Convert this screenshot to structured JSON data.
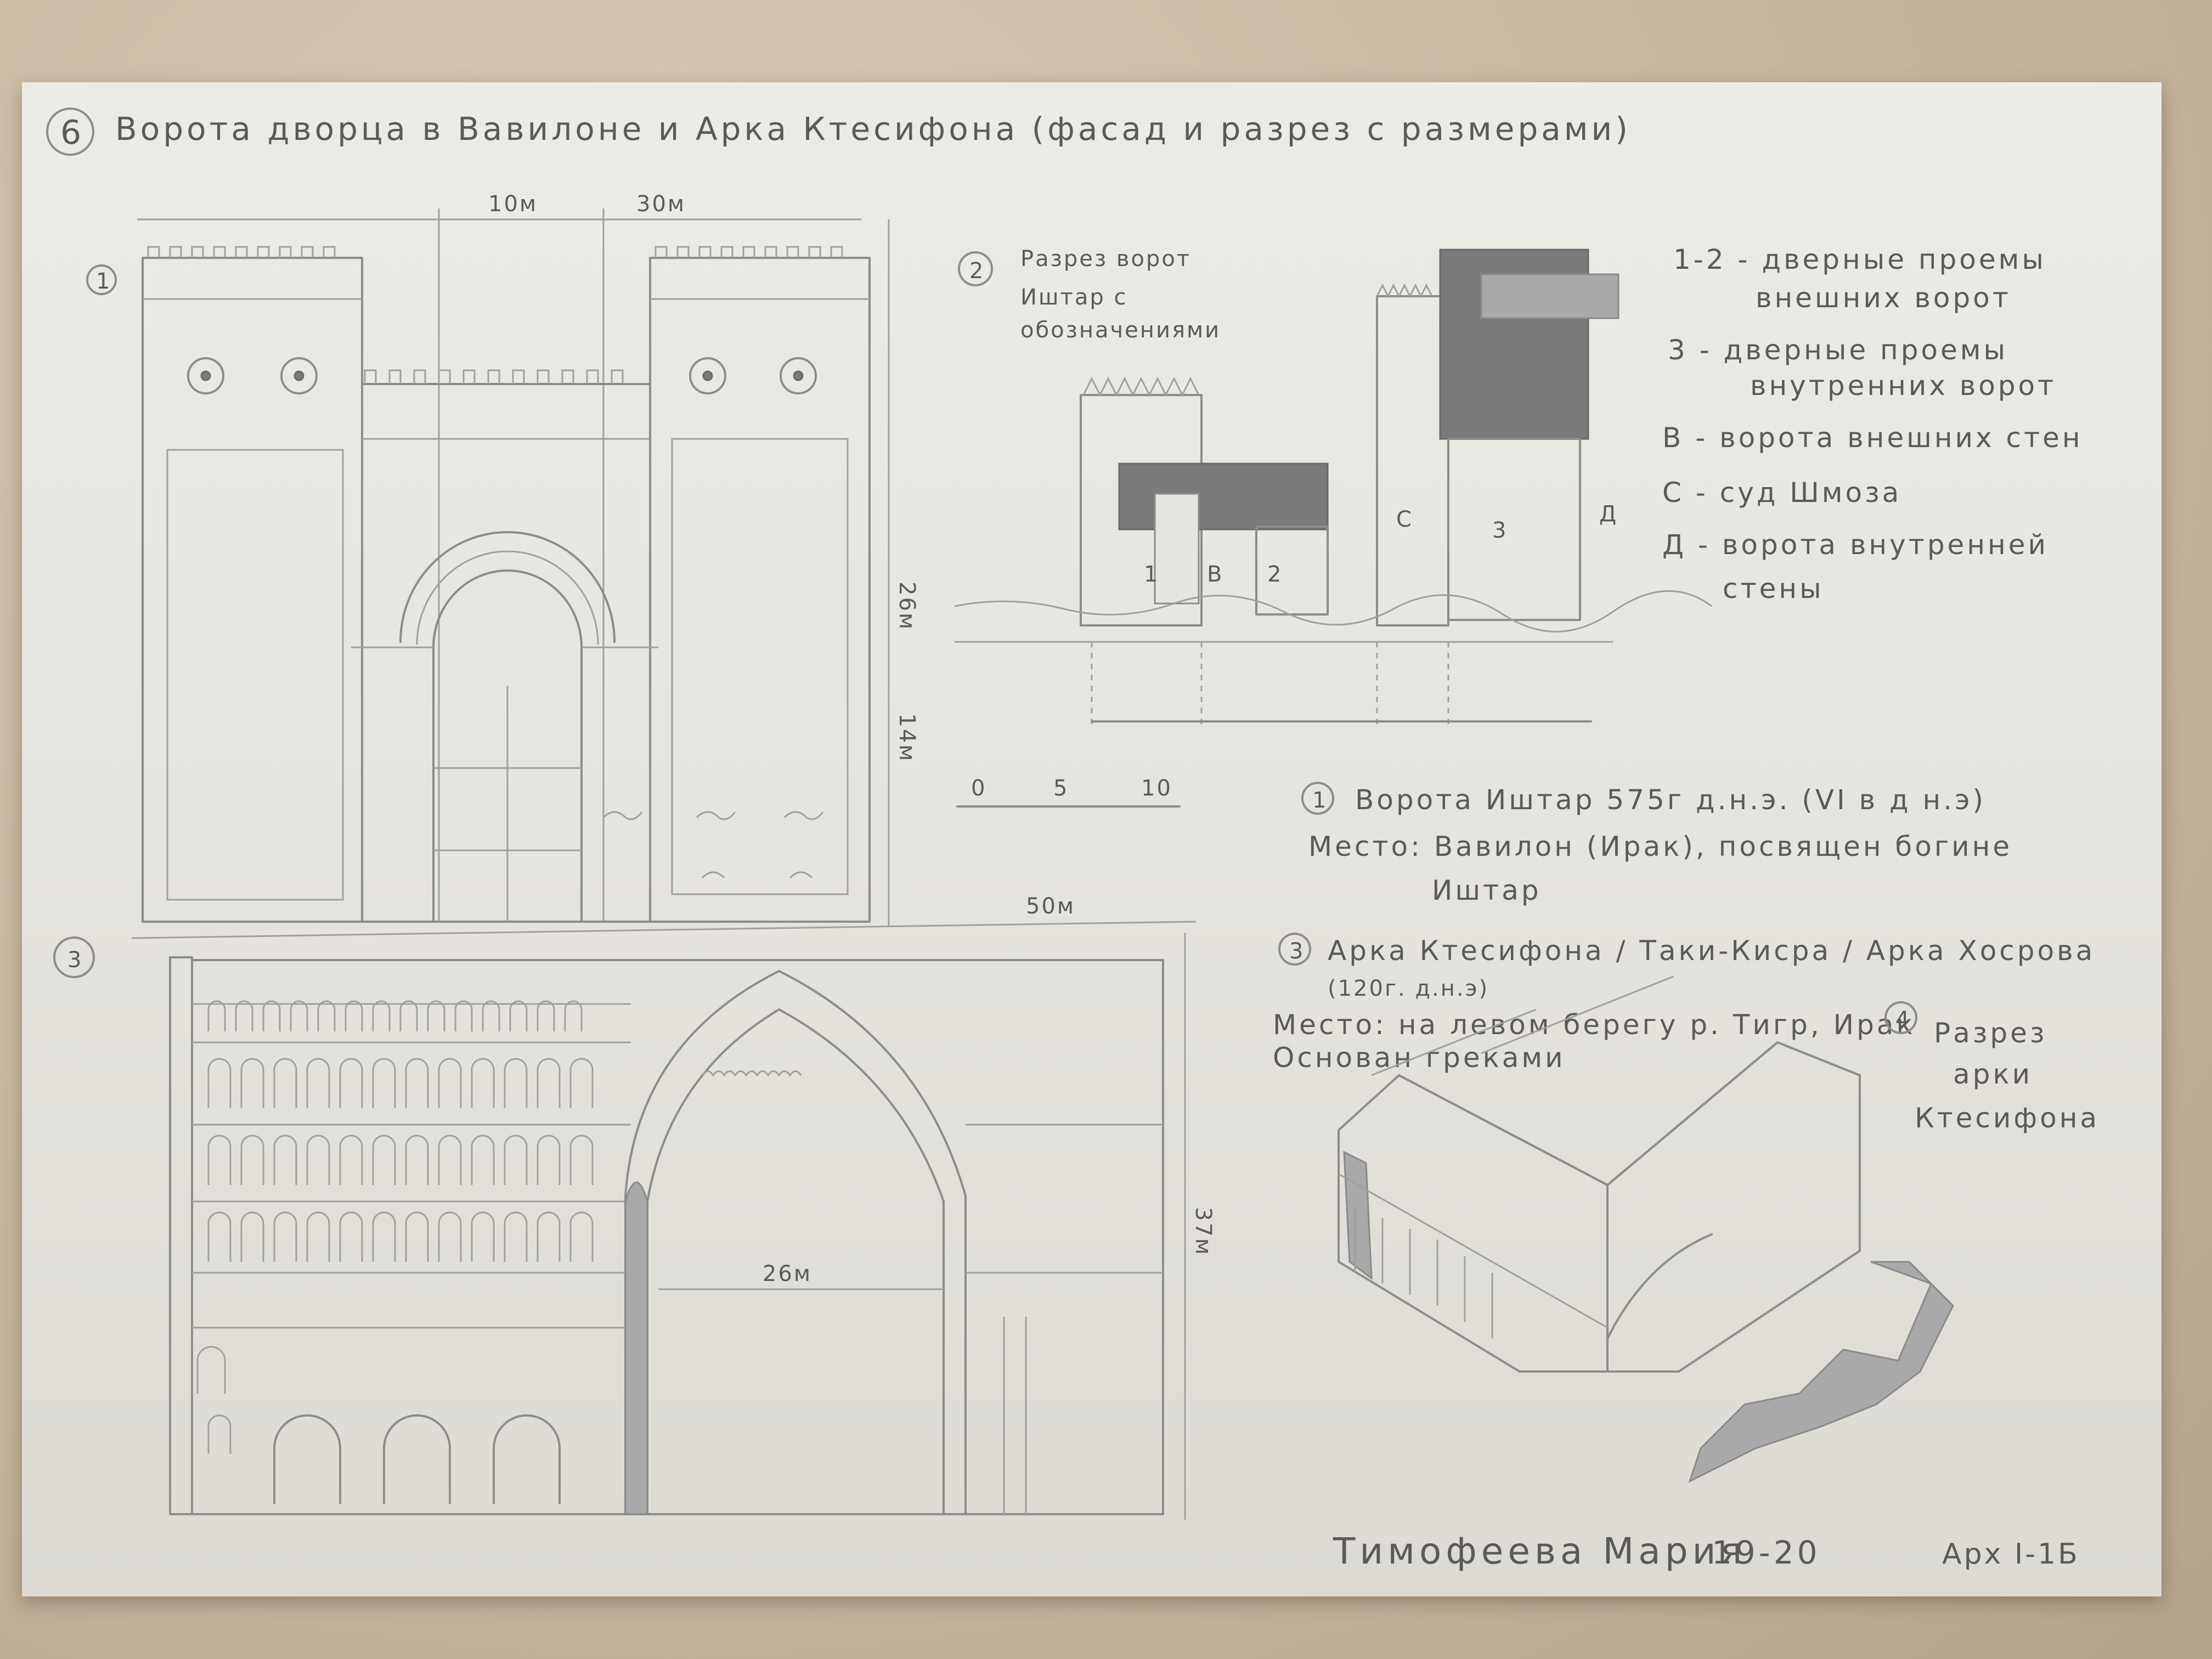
{
  "sheet": {
    "number": "6",
    "title": "Ворота дворца в Вавилоне и Арка Ктесифона (фасад и разрез с размерами)"
  },
  "drawing1": {
    "number": "1",
    "dims": {
      "d1": "10м",
      "d2": "30м",
      "d3": "26м",
      "d4": "14м",
      "d5": "50м"
    }
  },
  "drawing2": {
    "number": "2",
    "title_line1": "Разрез ворот",
    "title_line2": "Иштар с",
    "title_line3": "обозначениями",
    "labels": {
      "a": "1",
      "b": "В",
      "c": "2",
      "d": "С",
      "e": "3",
      "f": "Д"
    },
    "scale": {
      "s0": "0",
      "s5": "5",
      "s10": "10"
    }
  },
  "legend": {
    "line1": "1-2 - дверные проемы",
    "line2": "внешних ворот",
    "line3": "3 - дверные проемы",
    "line4": "внутренних ворот",
    "line5": "В - ворота внешних стен",
    "line6": "С - суд Шмоза",
    "line7": "Д - ворота внутренней",
    "line8": "стены"
  },
  "notes": {
    "n1_num": "1",
    "n1_title": "Ворота Иштар 575г д.н.э. (VI в д н.э)",
    "n1_place": "Место: Вавилон (Ирак), посвящен богине",
    "n1_place2": "Иштар",
    "n3_num": "3",
    "n3_title": "Арка Ктесифона / Таки-Кисра / Арка Хосрова",
    "n3_date": "(120г. д.н.э)",
    "n3_place": "Место: на левом берегу р. Тигр, Ирак",
    "n3_founded": "Основан греками"
  },
  "drawing3": {
    "number": "3",
    "dims": {
      "w": "26м",
      "h": "37м"
    }
  },
  "drawing4": {
    "number": "4",
    "title_line1": "Разрез",
    "title_line2": "арки",
    "title_line3": "Ктесифона"
  },
  "signature": {
    "name": "Тимофеева Мария",
    "year": "19-20",
    "group": "Арх I-1Б"
  }
}
